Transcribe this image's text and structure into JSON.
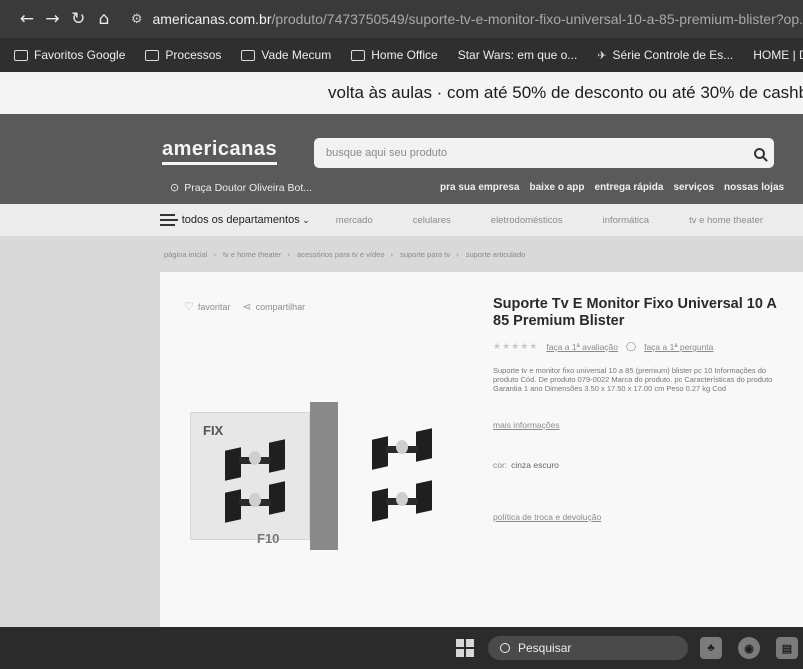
{
  "browser": {
    "nav": {
      "back": "←",
      "forward": "→",
      "reload": "↻",
      "home": "⌂"
    },
    "url_host": "americanas.com.br",
    "url_path": "/produto/7473750549/suporte-tv-e-monitor-fixo-universal-10-a-85-premium-blister?op...",
    "bookmarks": [
      "Favoritos Google",
      "Processos",
      "Vade Mecum",
      "Home Office",
      "Star Wars: em que o...",
      "Série Controle de Es...",
      "HOME | D"
    ]
  },
  "promo": {
    "text": "volta às aulas · com até 50% de desconto ou até 30% de cashb"
  },
  "header": {
    "logo": "americanas",
    "search_placeholder": "busque aqui seu produto",
    "location": "Praça Doutor Oliveira Bot...",
    "links": [
      "pra sua empresa",
      "baixe o app",
      "entrega rápida",
      "serviços",
      "nossas lojas"
    ]
  },
  "nav": {
    "departments_label": "todos os departamentos",
    "categories": [
      "mercado",
      "celulares",
      "eletrodomésticos",
      "informática",
      "tv e home theater"
    ]
  },
  "breadcrumbs": [
    "página inicial",
    "tv e home theater",
    "acessórios para tv e vídeo",
    "suporte para tv",
    "suporte articulado"
  ],
  "product": {
    "favorite_label": "favoritar",
    "share_label": "compartilhar",
    "image_brand": "FIX",
    "image_code": "F10",
    "title": "Suporte Tv E Monitor Fixo Universal 10 A 85 Premium Blister",
    "review_link": "faça a 1ª avaliação",
    "question_link": "faça a 1ª pergunta",
    "description": "Suporte tv e monitor fixo universal 10 a 85 (premium) blister pc 10 Informações do produto Cód. De produto 079-0022 Marca do produto. pc Características do produto Garantia 1 ano Dimensões 3.50 x 17.50 x 17.00 cm Peso 0.27 kg Cod",
    "more_info": "mais informações",
    "color_label": "cor:",
    "color_value": "cinza escuro",
    "policy_link": "política de troca e devolução"
  },
  "taskbar": {
    "search_label": "Pesquisar"
  }
}
